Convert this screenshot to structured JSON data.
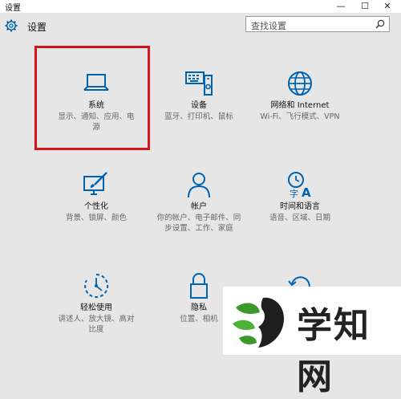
{
  "window": {
    "title": "设置"
  },
  "header": {
    "title": "设置"
  },
  "search": {
    "placeholder": "查找设置"
  },
  "tiles": [
    {
      "title": "系统",
      "desc": "显示、通知、应用、电源",
      "icon": "laptop-icon"
    },
    {
      "title": "设备",
      "desc": "蓝牙、打印机、鼠标",
      "icon": "keyboard-printer-icon"
    },
    {
      "title": "网络和 Internet",
      "desc": "Wi-Fi、飞行模式、VPN",
      "icon": "globe-icon"
    },
    {
      "title": "个性化",
      "desc": "背景、锁屏、颜色",
      "icon": "paint-monitor-icon"
    },
    {
      "title": "帐户",
      "desc": "你的帐户、电子邮件、同步设置、工作、家庭",
      "icon": "person-icon"
    },
    {
      "title": "时间和语言",
      "desc": "语音、区域、日期",
      "icon": "clock-language-icon"
    },
    {
      "title": "轻松使用",
      "desc": "讲述人、放大镜、高对比度",
      "icon": "ease-of-access-icon"
    },
    {
      "title": "隐私",
      "desc": "位置、相机",
      "icon": "lock-icon"
    },
    {
      "title": "",
      "desc": "",
      "icon": "update-icon"
    }
  ],
  "watermark": {
    "text": "学知网"
  },
  "colors": {
    "accent": "#0063b1",
    "highlight": "#d4161a",
    "background": "#e6e6e6"
  }
}
